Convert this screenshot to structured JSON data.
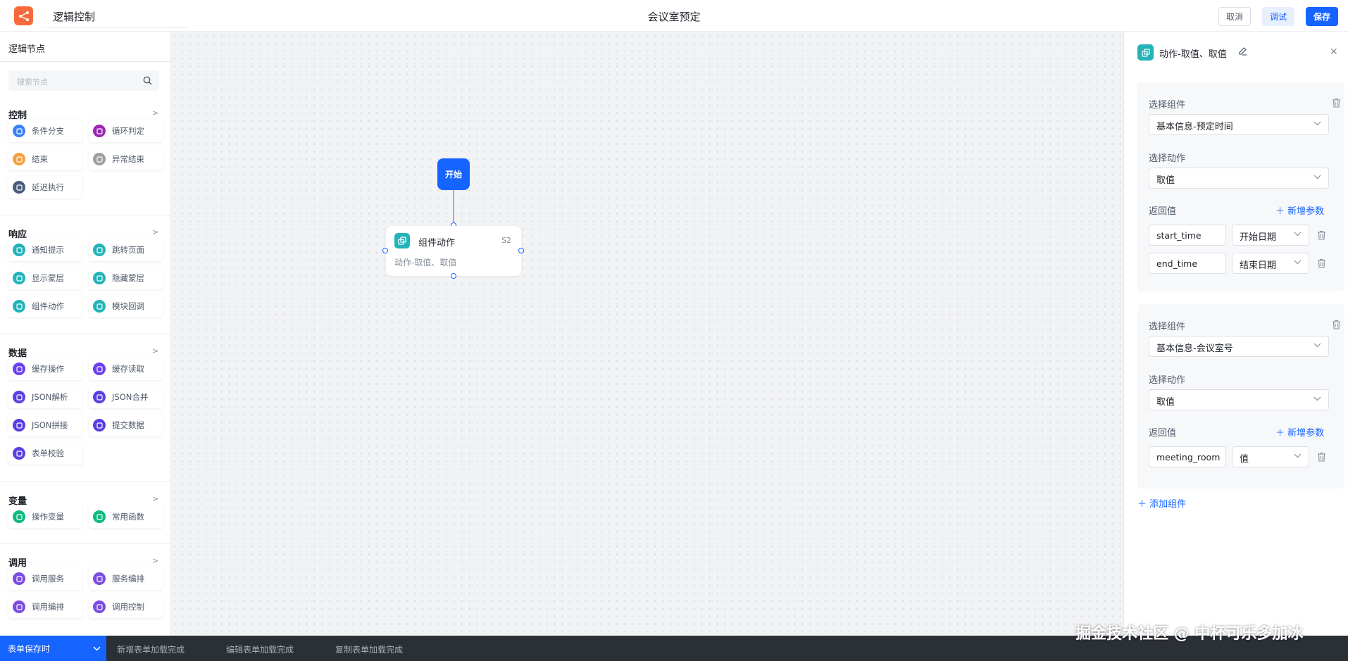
{
  "header": {
    "app_title": "逻辑控制",
    "page_title": "会议室预定",
    "cancel_label": "取消",
    "debug_label": "调试",
    "save_label": "保存"
  },
  "sidebar": {
    "title": "逻辑节点",
    "search_placeholder": "搜索节点",
    "groups": [
      {
        "title": "控制",
        "items": [
          {
            "label": "条件分支",
            "icon": "branch-icon",
            "color": "#3b82f6"
          },
          {
            "label": "循环判定",
            "icon": "loop-icon",
            "color": "#9c27b0"
          },
          {
            "label": "结束",
            "icon": "end-icon",
            "color": "#f59e42"
          },
          {
            "label": "异常结束",
            "icon": "error-end-icon",
            "color": "#9e9e9e"
          },
          {
            "label": "延迟执行",
            "icon": "delay-icon",
            "color": "#4b5b7a"
          }
        ]
      },
      {
        "title": "响应",
        "items": [
          {
            "label": "通知提示",
            "icon": "bell-icon",
            "color": "#23b3b8"
          },
          {
            "label": "跳转页面",
            "icon": "redirect-icon",
            "color": "#23b3b8"
          },
          {
            "label": "显示蒙层",
            "icon": "show-mask-icon",
            "color": "#23b3b8"
          },
          {
            "label": "隐藏蒙层",
            "icon": "hide-mask-icon",
            "color": "#23b3b8"
          },
          {
            "label": "组件动作",
            "icon": "component-action-icon",
            "color": "#23b3b8"
          },
          {
            "label": "模块回调",
            "icon": "module-callback-icon",
            "color": "#23b3b8"
          }
        ]
      },
      {
        "title": "数据",
        "items": [
          {
            "label": "缓存操作",
            "icon": "cache-op-icon",
            "color": "#6d3ff0"
          },
          {
            "label": "缓存读取",
            "icon": "cache-read-icon",
            "color": "#6d3ff0"
          },
          {
            "label": "JSON解析",
            "icon": "json-parse-icon",
            "color": "#5b3fe0"
          },
          {
            "label": "JSON合并",
            "icon": "json-merge-icon",
            "color": "#5b3fe0"
          },
          {
            "label": "JSON拼接",
            "icon": "json-concat-icon",
            "color": "#5b3fe0"
          },
          {
            "label": "提交数据",
            "icon": "submit-data-icon",
            "color": "#5b3fe0"
          },
          {
            "label": "表单校验",
            "icon": "form-validate-icon",
            "color": "#5b3fe0"
          }
        ]
      },
      {
        "title": "变量",
        "items": [
          {
            "label": "操作变量",
            "icon": "variable-icon",
            "color": "#10b981"
          },
          {
            "label": "常用函数",
            "icon": "function-icon",
            "color": "#10b981"
          }
        ]
      },
      {
        "title": "调用",
        "items": [
          {
            "label": "调用服务",
            "icon": "call-service-icon",
            "color": "#7c4ddf"
          },
          {
            "label": "服务编排",
            "icon": "service-orchestration-icon",
            "color": "#7c4ddf"
          },
          {
            "label": "调用编排",
            "icon": "call-orchestration-icon",
            "color": "#7c4ddf"
          },
          {
            "label": "调用控制",
            "icon": "call-control-icon",
            "color": "#7c4ddf"
          }
        ]
      }
    ]
  },
  "canvas": {
    "start_label": "开始",
    "node": {
      "title": "组件动作",
      "id": "S2",
      "subtitle": "动作-取值、取值"
    }
  },
  "panel": {
    "title": "动作-取值、取值",
    "cards": [
      {
        "component_label": "选择组件",
        "component_value": "基本信息-预定时间",
        "action_label": "选择动作",
        "action_value": "取值",
        "return_label": "返回值",
        "add_param_label": "新增参数",
        "params": [
          {
            "name": "start_time",
            "type": "开始日期"
          },
          {
            "name": "end_time",
            "type": "结束日期"
          }
        ]
      },
      {
        "component_label": "选择组件",
        "component_value": "基本信息-会议室号",
        "action_label": "选择动作",
        "action_value": "取值",
        "return_label": "返回值",
        "add_param_label": "新增参数",
        "params": [
          {
            "name": "meeting_room",
            "type": "值"
          }
        ]
      }
    ],
    "add_component_label": "添加组件"
  },
  "bottom_bar": {
    "active_tab": "表单保存时",
    "tabs": [
      "新增表单加载完成",
      "编辑表单加载完成",
      "复制表单加载完成"
    ]
  },
  "watermark": "掘金技术社区 @ 中杯可乐多加冰",
  "colors": {
    "primary": "#1664ff",
    "teal": "#23b3b8",
    "logo": "#f76a3c"
  }
}
